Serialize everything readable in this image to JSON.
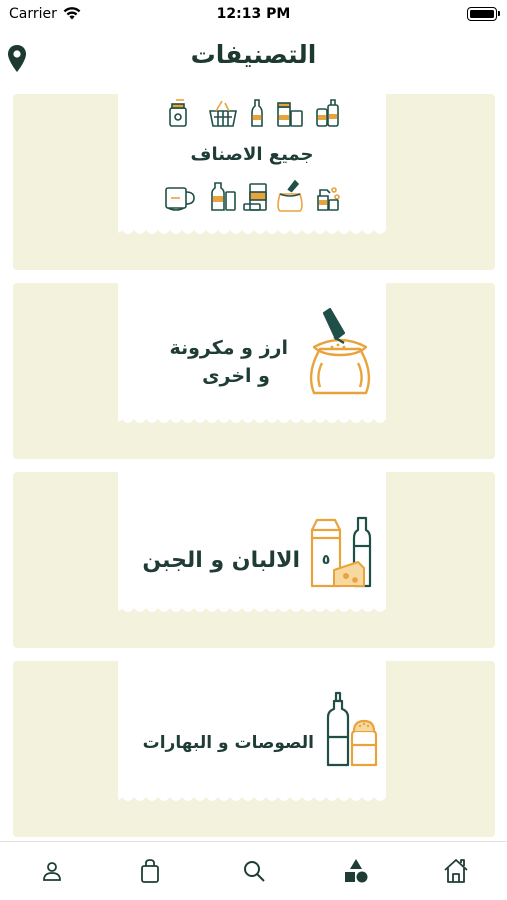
{
  "status_bar": {
    "carrier": "Carrier",
    "time": "12:13 PM"
  },
  "header": {
    "title": "التصنيفات",
    "location_icon": "map-pin-icon"
  },
  "categories": [
    {
      "label": "جميع الاصناف",
      "icons": [
        "jar-icon",
        "basket-icon",
        "bottle-icon",
        "jars-icon",
        "cleaning-bottles-icon",
        "coffee-cup-icon",
        "milk-bottle-icon",
        "can-icon",
        "sack-icon",
        "spray-bottle-icon"
      ]
    },
    {
      "label_line1": "ارز و مكرونة",
      "label_line2": "و اخرى",
      "icon": "rice-sack-icon"
    },
    {
      "label": "الالبان و الجبن",
      "icon": "milk-cheese-icon"
    },
    {
      "label": "الصوصات و البهارات",
      "icon": "sauce-spice-icon"
    }
  ],
  "tab_bar": {
    "tabs": [
      "profile-icon",
      "bag-icon",
      "search-icon",
      "categories-icon",
      "home-icon"
    ],
    "active": "categories-icon"
  },
  "colors": {
    "card_bg": "#f2f2dd",
    "accent_green": "#1f4f47",
    "accent_orange": "#e8a33d",
    "title": "#1e3931"
  }
}
